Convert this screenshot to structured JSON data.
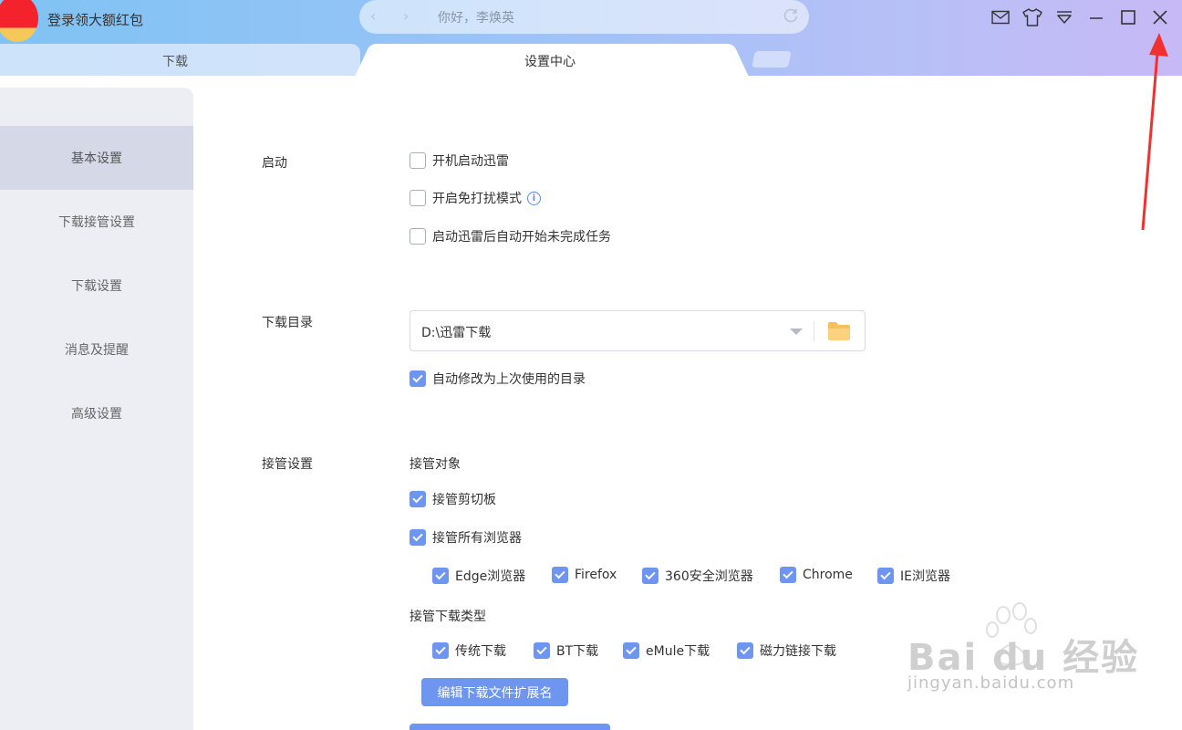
{
  "titlebar": {
    "app_title": "登录领大额红包",
    "search_text": "你好，李焕英"
  },
  "tabs": {
    "download": "下载",
    "settings": "设置中心"
  },
  "sidebar": {
    "items": [
      {
        "label": "基本设置",
        "active": true
      },
      {
        "label": "下载接管设置",
        "active": false
      },
      {
        "label": "下载设置",
        "active": false
      },
      {
        "label": "消息及提醒",
        "active": false
      },
      {
        "label": "高级设置",
        "active": false
      }
    ]
  },
  "startup": {
    "label": "启动",
    "options": [
      {
        "label": "开机启动迅雷",
        "checked": false
      },
      {
        "label": "开启免打扰模式",
        "checked": false
      },
      {
        "label": "启动迅雷后自动开始未完成任务",
        "checked": false
      }
    ]
  },
  "download_dir": {
    "label": "下载目录",
    "value": "D:\\迅雷下载",
    "auto_change": {
      "label": "自动修改为上次使用的目录",
      "checked": true
    }
  },
  "takeover": {
    "label": "接管设置",
    "target_label": "接管对象",
    "clipboard": {
      "label": "接管剪切板",
      "checked": true
    },
    "all_browsers": {
      "label": "接管所有浏览器",
      "checked": true
    },
    "browsers": [
      {
        "label": "Edge浏览器",
        "checked": true
      },
      {
        "label": "Firefox",
        "checked": true
      },
      {
        "label": "360安全浏览器",
        "checked": true
      },
      {
        "label": "Chrome",
        "checked": true
      },
      {
        "label": "IE浏览器",
        "checked": true
      }
    ],
    "types_label": "接管下载类型",
    "types": [
      {
        "label": "传统下载",
        "checked": true
      },
      {
        "label": "BT下载",
        "checked": true
      },
      {
        "label": "eMule下载",
        "checked": true
      },
      {
        "label": "磁力链接下载",
        "checked": true
      }
    ],
    "edit_ext_button": "编辑下载文件扩展名"
  },
  "watermark": {
    "brand": "Bai du 经验",
    "url": "jingyan.baidu.com"
  },
  "colors": {
    "accent": "#6e96f0",
    "annotation_arrow": "#f23030"
  }
}
